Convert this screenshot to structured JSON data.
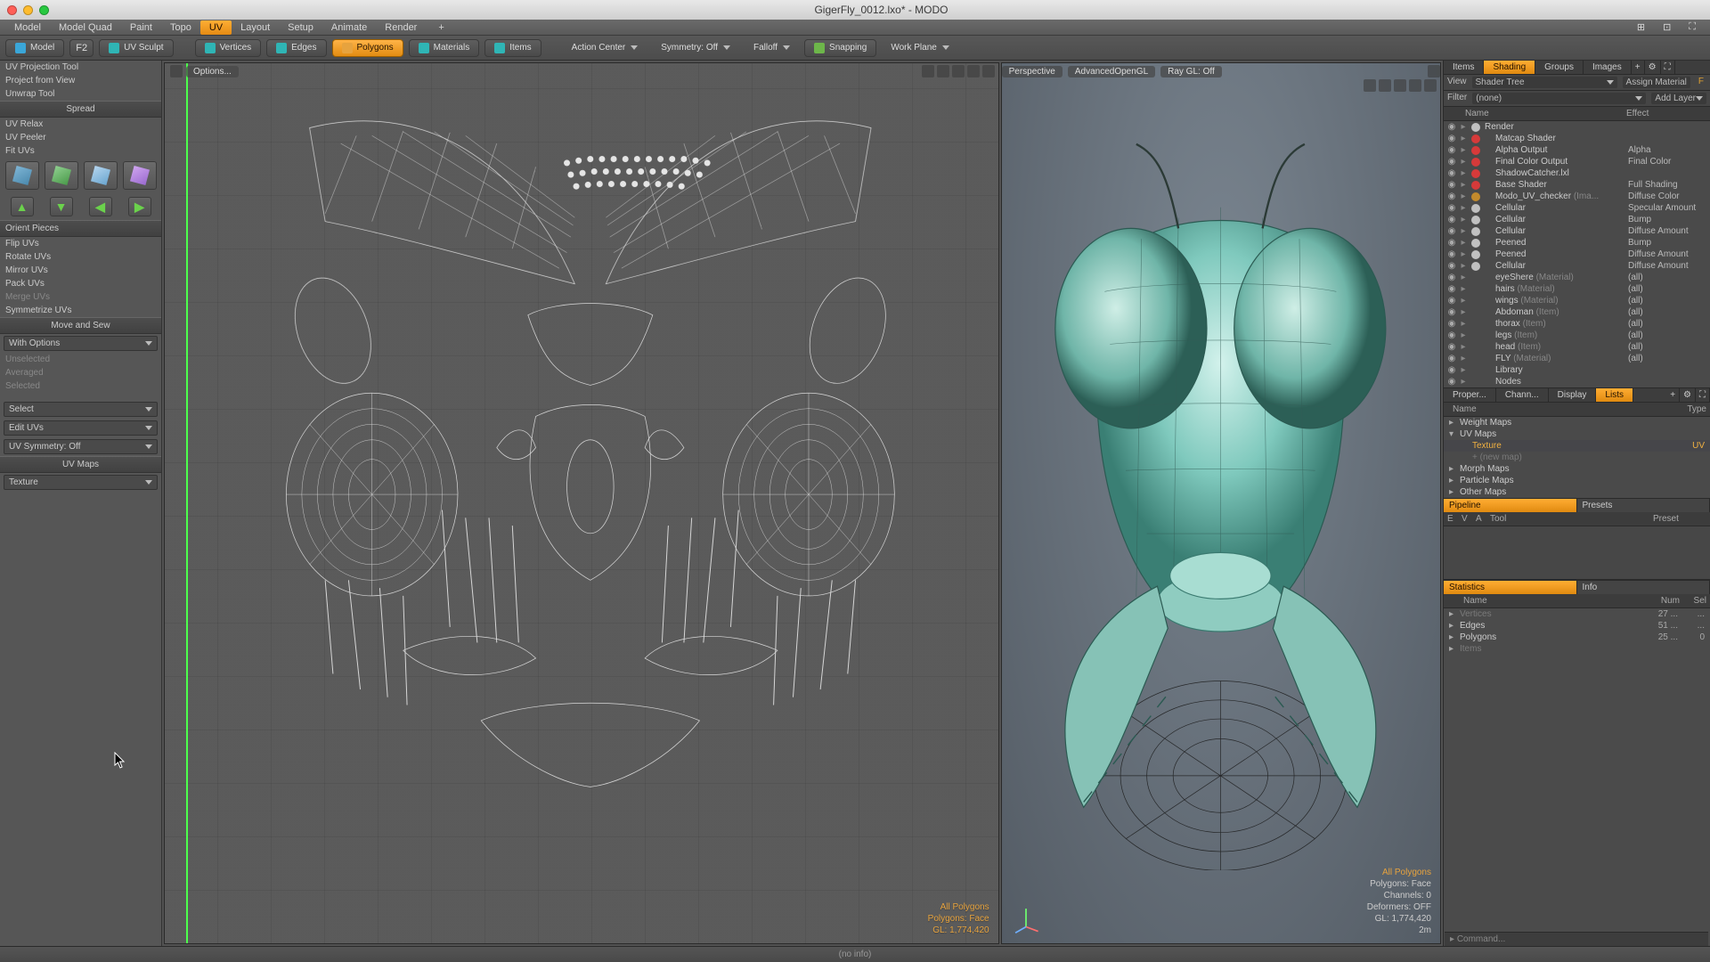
{
  "window": {
    "title": "GigerFly_0012.lxo* - MODO"
  },
  "menubar": {
    "items": [
      "Model",
      "Model Quad",
      "Paint",
      "Topo",
      "UV",
      "Layout",
      "Setup",
      "Animate",
      "Render"
    ],
    "active": "UV"
  },
  "toolbar": {
    "mode": {
      "label": "Model"
    },
    "f2": {
      "label": "F2"
    },
    "uvsculpt": {
      "label": "UV Sculpt"
    },
    "vertices": {
      "label": "Vertices"
    },
    "edges": {
      "label": "Edges"
    },
    "polygons": {
      "label": "Polygons"
    },
    "materials": {
      "label": "Materials"
    },
    "items": {
      "label": "Items"
    },
    "actioncenter": {
      "label": "Action Center"
    },
    "symmetry": {
      "label": "Symmetry: Off"
    },
    "falloff": {
      "label": "Falloff"
    },
    "snapping": {
      "label": "Snapping"
    },
    "workplane": {
      "label": "Work Plane"
    }
  },
  "left": {
    "tools": [
      "UV Projection Tool",
      "Project from View",
      "Unwrap Tool"
    ],
    "spread": {
      "header": "Spread",
      "items": [
        "UV Relax",
        "UV Peeler",
        "Fit UVs"
      ]
    },
    "orient": {
      "header": "Orient Pieces",
      "items": [
        "Flip UVs",
        "Rotate UVs",
        "Mirror UVs",
        "Pack UVs",
        "Merge UVs",
        "Symmetrize UVs"
      ]
    },
    "movesew": {
      "header": "Move and Sew",
      "option_label": "With Options",
      "dim_items": [
        "Unselected",
        "Averaged",
        "Selected"
      ]
    },
    "select": {
      "label": "Select"
    },
    "edituvs": {
      "label": "Edit UVs"
    },
    "uvsym": {
      "label": "UV Symmetry: Off"
    },
    "uvmaps": {
      "header": "UV Maps",
      "dropdown": "Texture"
    }
  },
  "uvview": {
    "options_label": "Options...",
    "overlay": {
      "l1": "All Polygons",
      "l2": "Polygons: Face",
      "l3": "GL: 1,774,420"
    }
  },
  "view3d": {
    "tabs": [
      "Perspective",
      "AdvancedOpenGL",
      "Ray GL: Off"
    ],
    "overlay": {
      "l1": "All Polygons",
      "l2": "Polygons: Face",
      "l3": "Channels: 0",
      "l4": "Deformers: OFF",
      "l5": "GL: 1,774,420",
      "l6": "2m"
    }
  },
  "right": {
    "top_tabs": [
      "Items",
      "Shading",
      "Groups",
      "Images"
    ],
    "top_active": "Shading",
    "sub": {
      "view": "View",
      "shadertree": "Shader Tree",
      "assign": "Assign Material"
    },
    "filter": {
      "label": "Filter",
      "value": "(none)",
      "addlayer": "Add Layer"
    },
    "tree_head": {
      "name": "Name",
      "effect": "Effect"
    },
    "tree": [
      {
        "ind": 0,
        "dot": "#c0c0c0",
        "name": "Render",
        "effect": ""
      },
      {
        "ind": 1,
        "dot": "#d63a3a",
        "name": "Matcap Shader",
        "effect": ""
      },
      {
        "ind": 1,
        "dot": "#d63a3a",
        "name": "Alpha Output",
        "effect": "Alpha"
      },
      {
        "ind": 1,
        "dot": "#d63a3a",
        "name": "Final Color Output",
        "effect": "Final Color"
      },
      {
        "ind": 1,
        "dot": "#d63a3a",
        "name": "ShadowCatcher.lxl",
        "effect": ""
      },
      {
        "ind": 1,
        "dot": "#d63a3a",
        "name": "Base Shader",
        "effect": "Full Shading"
      },
      {
        "ind": 1,
        "dot": "#c28a2c",
        "name": "Modo_UV_checker",
        "dim": "(Ima...",
        "effect": "Diffuse Color"
      },
      {
        "ind": 1,
        "dot": "#c0c0c0",
        "name": "Cellular",
        "effect": "Specular Amount"
      },
      {
        "ind": 1,
        "dot": "#c0c0c0",
        "name": "Cellular",
        "effect": "Bump"
      },
      {
        "ind": 1,
        "dot": "#c0c0c0",
        "name": "Cellular",
        "effect": "Diffuse Amount"
      },
      {
        "ind": 1,
        "dot": "#c0c0c0",
        "name": "Peened",
        "effect": "Bump"
      },
      {
        "ind": 1,
        "dot": "#c0c0c0",
        "name": "Peened",
        "effect": "Diffuse Amount"
      },
      {
        "ind": 1,
        "dot": "#c0c0c0",
        "name": "Cellular",
        "effect": "Diffuse Amount"
      },
      {
        "ind": 1,
        "dot": "",
        "name": "eyeShere",
        "dim": "(Material)",
        "effect": "(all)"
      },
      {
        "ind": 1,
        "dot": "",
        "name": "hairs",
        "dim": "(Material)",
        "effect": "(all)"
      },
      {
        "ind": 1,
        "dot": "",
        "name": "wings",
        "dim": "(Material)",
        "effect": "(all)"
      },
      {
        "ind": 1,
        "dot": "",
        "name": "Abdoman",
        "dim": "(Item)",
        "effect": "(all)"
      },
      {
        "ind": 1,
        "dot": "",
        "name": "thorax",
        "dim": "(Item)",
        "effect": "(all)"
      },
      {
        "ind": 1,
        "dot": "",
        "name": "legs",
        "dim": "(Item)",
        "effect": "(all)"
      },
      {
        "ind": 1,
        "dot": "",
        "name": "head",
        "dim": "(Item)",
        "effect": "(all)"
      },
      {
        "ind": 1,
        "dot": "",
        "name": "FLY",
        "dim": "(Material)",
        "effect": "(all)"
      },
      {
        "ind": 1,
        "dot": "",
        "name": "Library",
        "effect": ""
      },
      {
        "ind": 1,
        "dot": "",
        "name": "Nodes",
        "effect": ""
      }
    ],
    "mid_tabs": [
      "Proper...",
      "Chann...",
      "Display",
      "Lists"
    ],
    "mid_active": "Lists",
    "maps_head": {
      "name": "Name",
      "type": "Type"
    },
    "maps": {
      "groups": [
        "Weight Maps",
        "UV Maps",
        "Morph Maps",
        "Particle Maps",
        "Other Maps"
      ],
      "uv_items": [
        {
          "name": "Texture",
          "type": "UV",
          "sel": true
        },
        {
          "name": "+ (new map)",
          "type": "",
          "dim": true
        }
      ]
    },
    "pipe_tabs": [
      "Pipeline",
      "Presets"
    ],
    "pipe_head": [
      "E",
      "V",
      "A",
      "Tool",
      "Preset"
    ],
    "stat_tabs": [
      "Statistics",
      "Info"
    ],
    "stat_head": {
      "name": "Name",
      "num": "Num",
      "sel": "Sel"
    },
    "stats": [
      {
        "name": "Vertices",
        "num": "27 ...",
        "sel": "...",
        "dim": true
      },
      {
        "name": "Edges",
        "num": "51 ...",
        "sel": "..."
      },
      {
        "name": "Polygons",
        "num": "25 ...",
        "sel": "0"
      },
      {
        "name": "Items",
        "num": "",
        "sel": "",
        "dim": true
      }
    ],
    "command": "Command..."
  },
  "statusbar": {
    "text": "(no info)"
  }
}
